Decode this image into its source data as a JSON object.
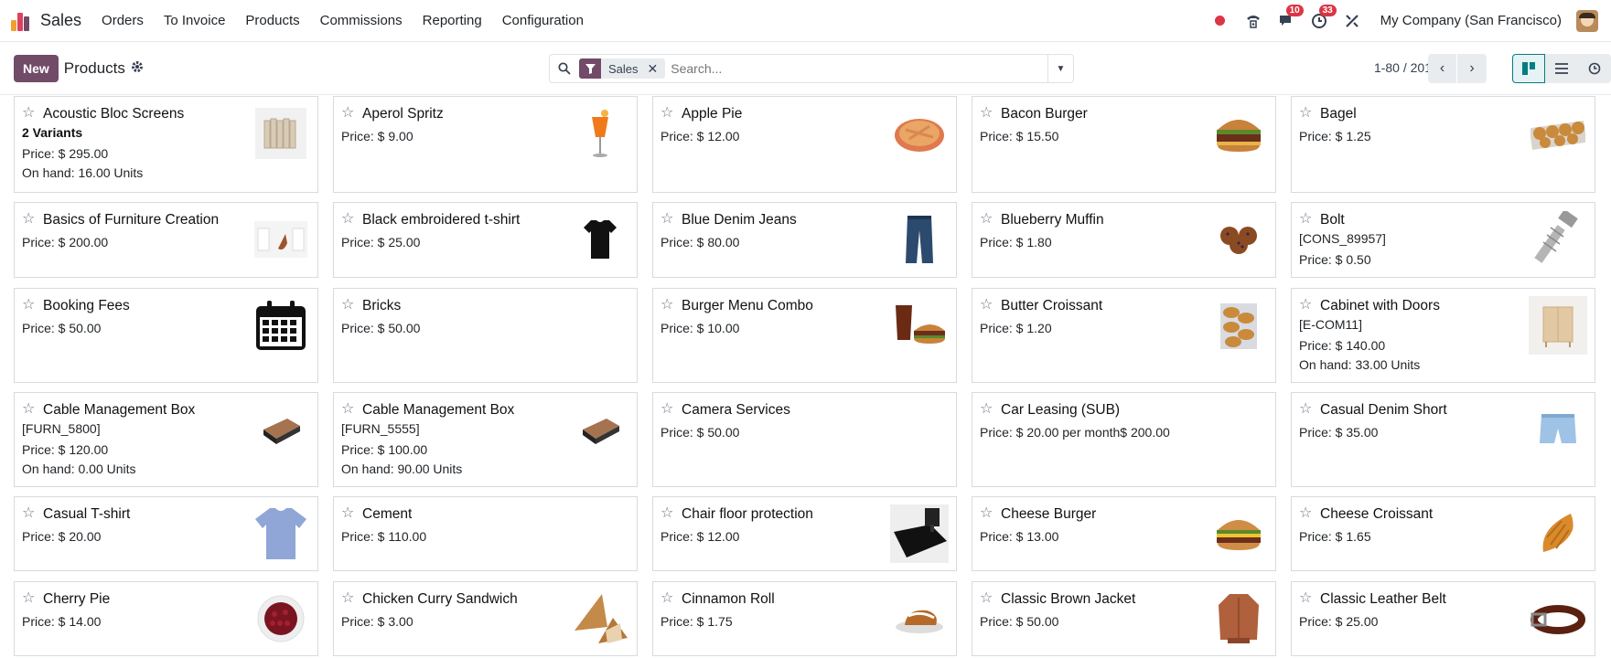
{
  "navbar": {
    "brand": "Sales",
    "menu": [
      "Orders",
      "To Invoice",
      "Products",
      "Commissions",
      "Reporting",
      "Configuration"
    ],
    "chat_badge": "10",
    "activity_badge": "33",
    "company": "My Company (San Francisco)"
  },
  "control": {
    "new_label": "New",
    "title": "Products",
    "facet_label": "Sales",
    "search_placeholder": "Search...",
    "pager": "1-80 / 201"
  },
  "colors": {
    "brand": "#714b67",
    "accent": "#017e84",
    "badge": "#dc3545"
  },
  "products": [
    {
      "name": "Acoustic Bloc Screens",
      "variants": "2 Variants",
      "price": "Price: $ 295.00",
      "onhand": "On hand: 16.00 Units",
      "icon": "acoustic-screen-image"
    },
    {
      "name": "Aperol Spritz",
      "price": "Price: $ 9.00",
      "icon": "cocktail-image"
    },
    {
      "name": "Apple Pie",
      "price": "Price: $ 12.00",
      "icon": "pie-image"
    },
    {
      "name": "Bacon Burger",
      "price": "Price: $ 15.50",
      "icon": "burger-image"
    },
    {
      "name": "Bagel",
      "price": "Price: $ 1.25",
      "icon": "bagel-image"
    },
    {
      "name": "Basics of Furniture Creation",
      "price": "Price: $ 200.00",
      "icon": "furniture-course-image"
    },
    {
      "name": "Black embroidered t-shirt",
      "price": "Price: $ 25.00",
      "icon": "black-tshirt-image"
    },
    {
      "name": "Blue Denim Jeans",
      "price": "Price: $ 80.00",
      "icon": "jeans-image"
    },
    {
      "name": "Blueberry Muffin",
      "price": "Price: $ 1.80",
      "icon": "muffin-image"
    },
    {
      "name": "Bolt",
      "ref": "[CONS_89957]",
      "price": "Price: $ 0.50",
      "icon": "bolt-image"
    },
    {
      "name": "Booking Fees",
      "price": "Price: $ 50.00",
      "icon": "calendar-image"
    },
    {
      "name": "Bricks",
      "price": "Price: $ 50.00",
      "icon": ""
    },
    {
      "name": "Burger Menu Combo",
      "price": "Price: $ 10.00",
      "icon": "burger-combo-image"
    },
    {
      "name": "Butter Croissant",
      "price": "Price: $ 1.20",
      "icon": "croissant-box-image"
    },
    {
      "name": "Cabinet with Doors",
      "ref": "[E-COM11]",
      "price": "Price: $ 140.00",
      "onhand": "On hand: 33.00 Units",
      "icon": "cabinet-image"
    },
    {
      "name": "Cable Management Box",
      "ref": "[FURN_5800]",
      "price": "Price: $ 120.00",
      "onhand": "On hand: 0.00 Units",
      "icon": "cable-box-image"
    },
    {
      "name": "Cable Management Box",
      "ref": "[FURN_5555]",
      "price": "Price: $ 100.00",
      "onhand": "On hand: 90.00 Units",
      "icon": "cable-box-image"
    },
    {
      "name": "Camera Services",
      "price": "Price: $ 50.00",
      "icon": ""
    },
    {
      "name": "Car Leasing (SUB)",
      "price": "Price: $ 20.00 per month$ 200.00",
      "icon": ""
    },
    {
      "name": "Casual Denim Short",
      "price": "Price: $ 35.00",
      "icon": "denim-short-image"
    },
    {
      "name": "Casual T-shirt",
      "price": "Price: $ 20.00",
      "icon": "blue-tshirt-image"
    },
    {
      "name": "Cement",
      "price": "Price: $ 110.00",
      "icon": ""
    },
    {
      "name": "Chair floor protection",
      "price": "Price: $ 12.00",
      "icon": "floor-mat-image"
    },
    {
      "name": "Cheese Burger",
      "price": "Price: $ 13.00",
      "icon": "cheeseburger-image"
    },
    {
      "name": "Cheese Croissant",
      "price": "Price: $ 1.65",
      "icon": "croissant-image"
    },
    {
      "name": "Cherry Pie",
      "price": "Price: $ 14.00",
      "icon": "cherry-pie-image"
    },
    {
      "name": "Chicken Curry Sandwich",
      "price": "Price: $ 3.00",
      "icon": "sandwich-image"
    },
    {
      "name": "Cinnamon Roll",
      "price": "Price: $ 1.75",
      "icon": "cinnamon-roll-image"
    },
    {
      "name": "Classic Brown Jacket",
      "price": "Price: $ 50.00",
      "icon": "jacket-image"
    },
    {
      "name": "Classic Leather Belt",
      "price": "Price: $ 25.00",
      "icon": "belt-image"
    }
  ]
}
